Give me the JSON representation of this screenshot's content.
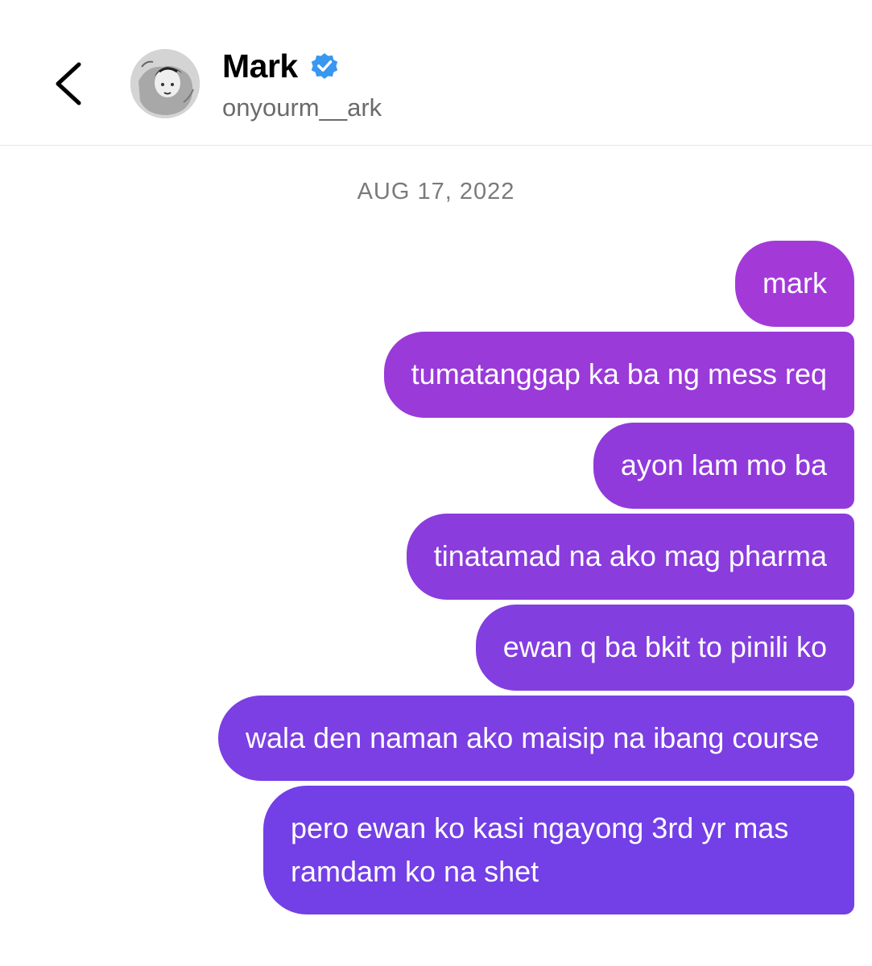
{
  "header": {
    "name": "Mark",
    "username": "onyourm__ark",
    "verified": true,
    "back_icon": "chevron-left-icon",
    "verified_icon": "verified-badge-icon",
    "accent_color": "#3897f0"
  },
  "thread": {
    "date": "AUG 17, 2022",
    "messages": [
      {
        "text": "mark",
        "from": "me"
      },
      {
        "text": "tumatanggap ka ba ng mess req",
        "from": "me"
      },
      {
        "text": "ayon lam mo ba",
        "from": "me"
      },
      {
        "text": "tinatamad na ako mag pharma",
        "from": "me"
      },
      {
        "text": "ewan q ba bkit to pinili ko",
        "from": "me"
      },
      {
        "text": "wala den naman ako maisip na ibang course",
        "from": "me"
      },
      {
        "text": "pero ewan ko kasi ngayong 3rd yr mas ramdam ko na shet",
        "from": "me"
      }
    ],
    "bubble_colors": [
      "#a33ad8",
      "#9a3ad9",
      "#913adb",
      "#8a3cdd",
      "#833ee0",
      "#7b3fe3",
      "#733fe6"
    ]
  }
}
